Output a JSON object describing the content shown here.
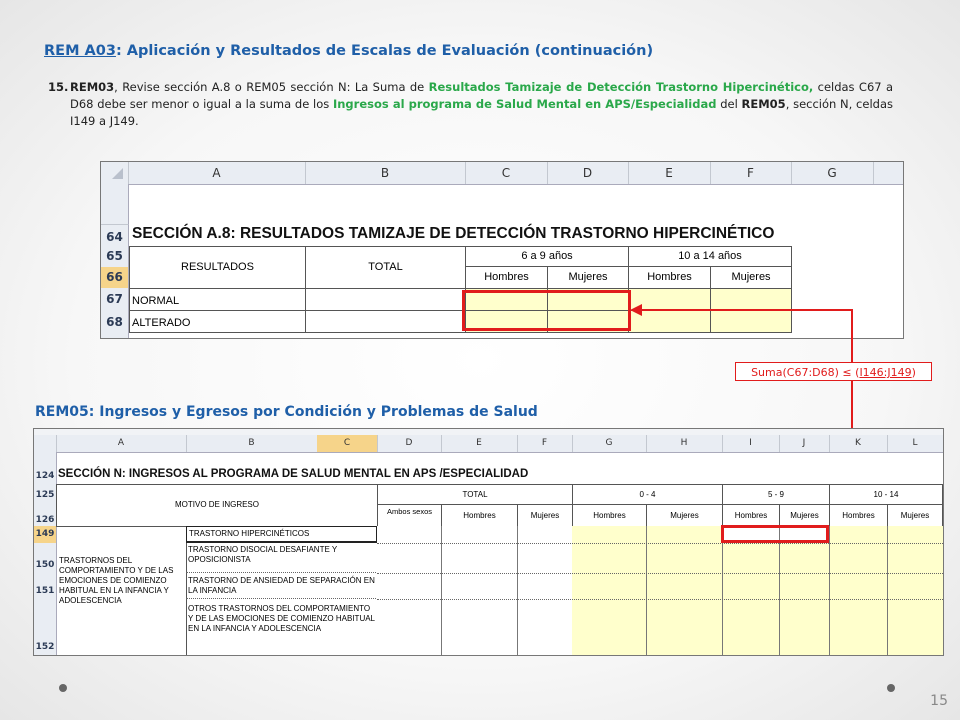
{
  "heading": {
    "ref": "REM A03",
    "rest": ": Aplicación y Resultados de Escalas de Evaluación (continuación)"
  },
  "item": {
    "number": "15.",
    "t1": "REM03",
    "t2": ", Revise sección A.8 o REM05 sección N: La Suma de ",
    "t3": "Resultados Tamizaje de Detección Trastorno Hipercinético,",
    "t4": " celdas C67 a D68 debe ser menor o igual a la suma de los ",
    "t5": "Ingresos al programa de Salud Mental en APS/Especialidad",
    "t6": " del ",
    "t7": "REM05",
    "t8": ", sección N, celdas I149 a J149."
  },
  "sheet1": {
    "columns": [
      "A",
      "B",
      "C",
      "D",
      "E",
      "F",
      "G"
    ],
    "rows": [
      "64",
      "65",
      "66",
      "67",
      "68"
    ],
    "section_title": "SECCIÓN A.8: RESULTADOS TAMIZAJE DE DETECCIÓN TRASTORNO HIPERCINÉTICO",
    "col_resultados": "RESULTADOS",
    "col_total": "TOTAL",
    "group1": "6 a 9 años",
    "group2": "10 a 14 años",
    "hombres": "Hombres",
    "mujeres": "Mujeres",
    "row_normal": "NORMAL",
    "row_alterado": "ALTERADO"
  },
  "formula_note": {
    "left": "Suma(C67:D68) ≤ (",
    "ref": "I146:J149",
    "right": ")"
  },
  "subheading": "REM05: Ingresos y Egresos por Condición y Problemas de Salud",
  "sheet2": {
    "columns": [
      "A",
      "B",
      "C",
      "D",
      "E",
      "F",
      "G",
      "H",
      "I",
      "J",
      "K",
      "L"
    ],
    "rows": [
      "124",
      "125",
      "126",
      "149",
      "150",
      "151",
      "152"
    ],
    "section_title": "SECCIÓN N: INGRESOS AL PROGRAMA DE SALUD  MENTAL EN APS /ESPECIALIDAD",
    "motivo": "MOTIVO DE INGRESO",
    "total": "TOTAL",
    "g1": "0 - 4",
    "g2": "5 - 9",
    "g3": "10 - 14",
    "ambos": "Ambos sexos",
    "hombres": "Hombres",
    "mujeres": "Mujeres",
    "category": "TRASTORNOS DEL COMPORTAMIENTO Y DE LAS EMOCIONES DE COMIENZO HABITUAL EN LA INFANCIA Y ADOLESCENCIA",
    "r149": "TRASTORNO HIPERCINÉTICOS",
    "r150": "TRASTORNO DISOCIAL DESAFIANTE Y OPOSICIONISTA",
    "r151": "TRASTORNO DE ANSIEDAD DE SEPARACIÓN EN LA INFANCIA",
    "r152": "OTROS TRASTORNOS DEL COMPORTAMIENTO Y DE LAS EMOCIONES DE COMIENZO HABITUAL EN LA INFANCIA Y ADOLESCENCIA"
  },
  "page_number": "15",
  "colors": {
    "accent": "#1f5fa8",
    "green": "#2aa84a",
    "red": "#e11c1c",
    "cell_fill": "#ffffcc"
  }
}
